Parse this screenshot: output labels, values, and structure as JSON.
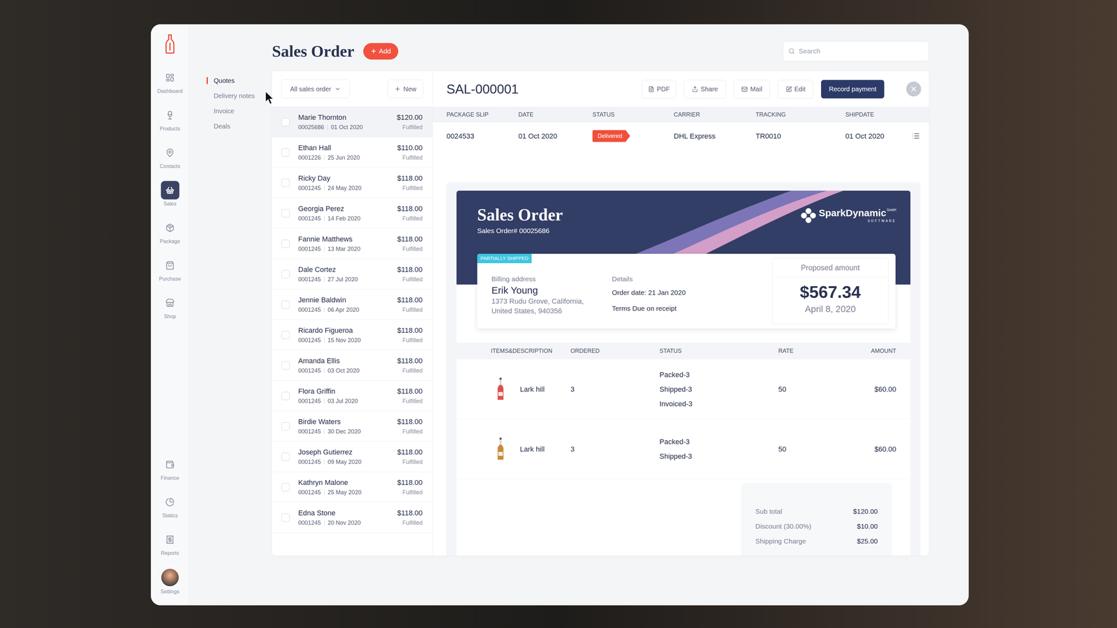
{
  "rail": {
    "items": [
      {
        "label": "Dashboard",
        "selected": false
      },
      {
        "label": "Products",
        "selected": false
      },
      {
        "label": "Contacts",
        "selected": false
      },
      {
        "label": "Sales",
        "selected": true
      },
      {
        "label": "Package",
        "selected": false
      },
      {
        "label": "Purchase",
        "selected": false
      },
      {
        "label": "Shop",
        "selected": false
      }
    ],
    "bottom_items": [
      {
        "label": "Finance",
        "selected": false
      },
      {
        "label": "Statics",
        "selected": false
      },
      {
        "label": "Reports",
        "selected": false
      }
    ],
    "settings": {
      "label": "Settings"
    }
  },
  "subnav": [
    {
      "label": "Quotes",
      "selected": true
    },
    {
      "label": "Delivery notes",
      "selected": false
    },
    {
      "label": "Invoice",
      "selected": false
    },
    {
      "label": "Deals",
      "selected": false
    }
  ],
  "header": {
    "title": "Sales Order",
    "add_button": "Add"
  },
  "search": {
    "placeholder": "Search"
  },
  "list": {
    "filter": "All sales order",
    "new_button": "New",
    "rows": [
      {
        "name": "Marie Thornton",
        "number": "00025686",
        "date": "01 Oct 2020",
        "amount": "$120.00",
        "status": "Fulfilled",
        "selected": true
      },
      {
        "name": "Ethan Hall",
        "number": "0001226",
        "date": "25 Jun 2020",
        "amount": "$110.00",
        "status": "Fulfilled",
        "selected": false
      },
      {
        "name": "Ricky Day",
        "number": "0001245",
        "date": "24 May 2020",
        "amount": "$118.00",
        "status": "Fulfilled",
        "selected": false
      },
      {
        "name": "Georgia Perez",
        "number": "0001245",
        "date": "14 Feb 2020",
        "amount": "$118.00",
        "status": "Fulfilled",
        "selected": false
      },
      {
        "name": "Fannie Matthews",
        "number": "0001245",
        "date": "13 Mar 2020",
        "amount": "$118.00",
        "status": "Fulfilled",
        "selected": false
      },
      {
        "name": "Dale Cortez",
        "number": "0001245",
        "date": "27 Jul 2020",
        "amount": "$118.00",
        "status": "Fulfilled",
        "selected": false
      },
      {
        "name": "Jennie Baldwin",
        "number": "0001245",
        "date": "06 Apr 2020",
        "amount": "$118.00",
        "status": "Fulfilled",
        "selected": false
      },
      {
        "name": "Ricardo Figueroa",
        "number": "0001245",
        "date": "15 Nov 2020",
        "amount": "$118.00",
        "status": "Fulfilled",
        "selected": false
      },
      {
        "name": "Amanda Ellis",
        "number": "0001245",
        "date": "03 Oct 2020",
        "amount": "$118.00",
        "status": "Fulfilled",
        "selected": false
      },
      {
        "name": "Flora Griffin",
        "number": "0001245",
        "date": "03 Jul 2020",
        "amount": "$118.00",
        "status": "Fulfilled",
        "selected": false
      },
      {
        "name": "Birdie Waters",
        "number": "0001245",
        "date": "30 Dec 2020",
        "amount": "$118.00",
        "status": "Fulfilled",
        "selected": false
      },
      {
        "name": "Joseph Gutierrez",
        "number": "0001245",
        "date": "09 May 2020",
        "amount": "$118.00",
        "status": "Fulfilled",
        "selected": false
      },
      {
        "name": "Kathryn Malone",
        "number": "0001245",
        "date": "25 May 2020",
        "amount": "$118.00",
        "status": "Fulfilled",
        "selected": false
      },
      {
        "name": "Edna Stone",
        "number": "0001245",
        "date": "20 Nov 2020",
        "amount": "$118.00",
        "status": "Fulfilled",
        "selected": false
      }
    ]
  },
  "detail": {
    "id": "SAL-000001",
    "actions": [
      "PDF",
      "Share",
      "Mail",
      "Edit"
    ],
    "primary_action": "Record payment",
    "shipments": {
      "columns": [
        "PACKAGE SLIP",
        "DATE",
        "STATUS",
        "CARRIER",
        "TRACKING",
        "SHIPDATE"
      ],
      "rows": [
        {
          "package_slip": "0024533",
          "date": "01 Oct 2020",
          "status": "Delivered",
          "carrier": "DHL Express",
          "tracking": "TR0010",
          "shipdate": "01 Oct 2020"
        }
      ]
    },
    "document": {
      "title": "Sales Order",
      "number": "Sales Order# 00025686",
      "brand": "SparkDynamic",
      "brand_suffix": "GmbH",
      "brand_tagline": "SOFTWARE",
      "badge": "PARTIALLY SHIPPED",
      "billing_label": "Billing address",
      "customer": "Erik Young",
      "address": [
        "1373 Rudu Grove, California,",
        "United States, 940356"
      ],
      "details_label": "Details",
      "order_date": "Order date: 21 Jan 2020",
      "terms": "Terms Due on receipt",
      "proposed_label": "Proposed amount",
      "proposed_amount": "$567.34",
      "proposed_date": "April 8, 2020",
      "item_columns": [
        "ITEMS&DESCRIPTION",
        "ORDERED",
        "STATUS",
        "RATE",
        "AMOUNT"
      ],
      "items": [
        {
          "name": "Lark hill",
          "ordered": "3",
          "status": [
            "Packed-3",
            "Shipped-3",
            "Invoiced-3"
          ],
          "rate": "50",
          "amount": "$60.00",
          "color": "#e0504a"
        },
        {
          "name": "Lark hill",
          "ordered": "3",
          "status": [
            "Packed-3",
            "Shipped-3"
          ],
          "rate": "50",
          "amount": "$60.00",
          "color": "#c98a3a"
        }
      ],
      "totals": [
        {
          "label": "Sub total",
          "value": "$120.00"
        },
        {
          "label": "Discount (30.00%)",
          "value": "$10.00"
        },
        {
          "label": "Shipping Charge",
          "value": "$25.00"
        }
      ]
    }
  }
}
